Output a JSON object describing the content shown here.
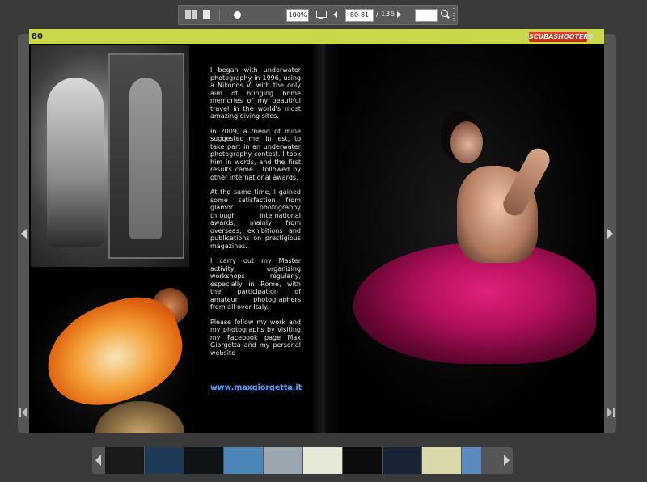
{
  "toolbar": {
    "zoom_value": "100%",
    "page_range": "80-81",
    "total_pages": "/ 136",
    "search_value": ""
  },
  "book": {
    "page_number": "80",
    "logo_part1": "SCUBA",
    "logo_part2": "SHOOTERS",
    "paragraphs": [
      "I began with underwater photography in 1996, using a Nikonos V, with the only aim of bringing home memories of my beautiful travel in the world's most amazing diving sites.",
      "In 2009, a friend of mine suggested me, in jest, to take part in an underwater photography contest. I took him in words, and the first results came... followed by other international awards.",
      "At the same time, I gained some satisfaction from glamor photography through international awards, mainly from overseas, exhibitions and publications on prestigious magazines.",
      "I carry out my Master activity organizing workshops regularly, especially in Rome, with the participation of amateur photographers from all over Italy.",
      "Please follow my work and my photographs by visiting my Facebook page Max Giorgetta and my personal website"
    ],
    "website": "www.maxgiorgetta.it"
  },
  "thumbnails": [
    {
      "color": "#1a1a1a",
      "width": 48
    },
    {
      "color": "#1e3a56",
      "width": 48
    },
    {
      "color": "#101418",
      "width": 48
    },
    {
      "color": "#4a86b8",
      "width": 48
    },
    {
      "color": "#9aa6b0",
      "width": 48
    },
    {
      "color": "#e8e8d8",
      "width": 48
    },
    {
      "color": "#0c0c0c",
      "width": 48
    },
    {
      "color": "#182436",
      "width": 48
    },
    {
      "color": "#d8d8a8",
      "width": 48
    },
    {
      "color": "#5a8ac0",
      "width": 24
    }
  ]
}
